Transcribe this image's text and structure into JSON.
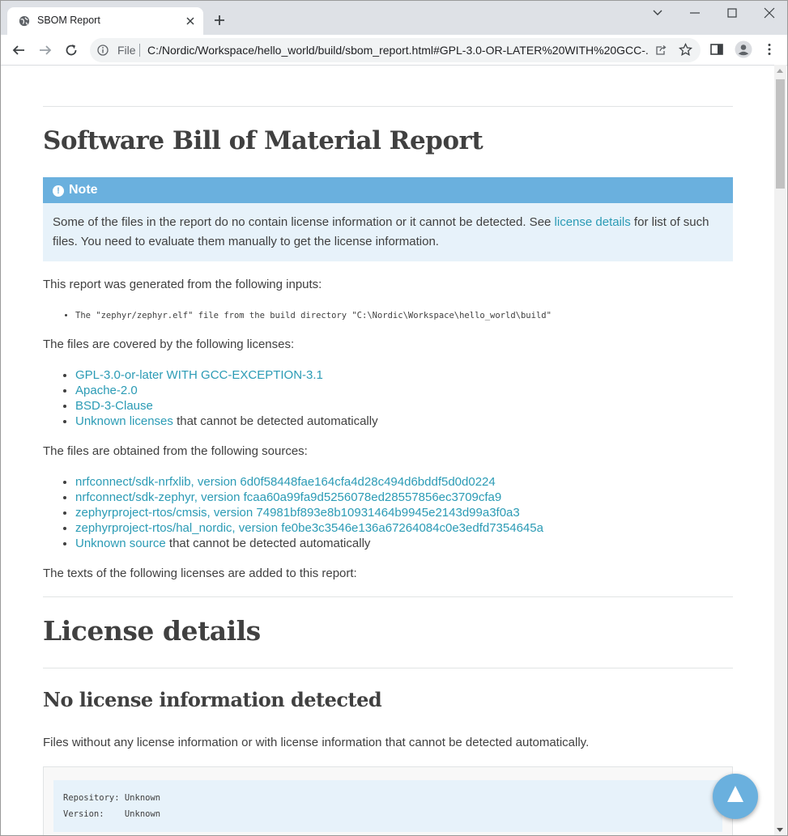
{
  "browser": {
    "tab_title": "SBOM Report",
    "scheme_label": "File",
    "url": "C:/Nordic/Workspace/hello_world/build/sbom_report.html#GPL-3.0-OR-LATER%20WITH%20GCC-..."
  },
  "page": {
    "title": "Software Bill of Material Report",
    "note": {
      "heading": "Note",
      "text_before": "Some of the files in the report do no contain license information or it cannot be detected. See ",
      "link": "license details",
      "text_after": " for list of such files. You need to evaluate them manually to get the license information."
    },
    "inputs_intro": "This report was generated from the following inputs:",
    "inputs": [
      "The \"zephyr/zephyr.elf\" file from the build directory \"C:\\Nordic\\Workspace\\hello_world\\build\""
    ],
    "licenses_intro": "The files are covered by the following licenses:",
    "licenses": [
      {
        "link": "GPL-3.0-or-later WITH GCC-EXCEPTION-3.1",
        "suffix": ""
      },
      {
        "link": "Apache-2.0",
        "suffix": ""
      },
      {
        "link": "BSD-3-Clause",
        "suffix": ""
      },
      {
        "link": "Unknown licenses",
        "suffix": " that cannot be detected automatically"
      }
    ],
    "sources_intro": "The files are obtained from the following sources:",
    "sources": [
      {
        "link": "nrfconnect/sdk-nrfxlib, version 6d0f58448fae164cfa4d28c494d6bddf5d0d0224",
        "suffix": ""
      },
      {
        "link": "nrfconnect/sdk-zephyr, version fcaa60a99fa9d5256078ed28557856ec3709cfa9",
        "suffix": ""
      },
      {
        "link": "zephyrproject-rtos/cmsis, version 74981bf893e8b10931464b9945e2143d99a3f0a3",
        "suffix": ""
      },
      {
        "link": "zephyrproject-rtos/hal_nordic, version fe0be3c3546e136a67264084c0e3edfd7354645a",
        "suffix": ""
      },
      {
        "link": "Unknown source",
        "suffix": " that cannot be detected automatically"
      }
    ],
    "texts_intro": "The texts of the following licenses are added to this report:",
    "license_details_heading": "License details",
    "no_license_heading": "No license information detected",
    "no_license_desc": "Files without any license information or with license information that cannot be detected automatically.",
    "code_lines": [
      "Repository: Unknown",
      "Version:    Unknown"
    ]
  }
}
